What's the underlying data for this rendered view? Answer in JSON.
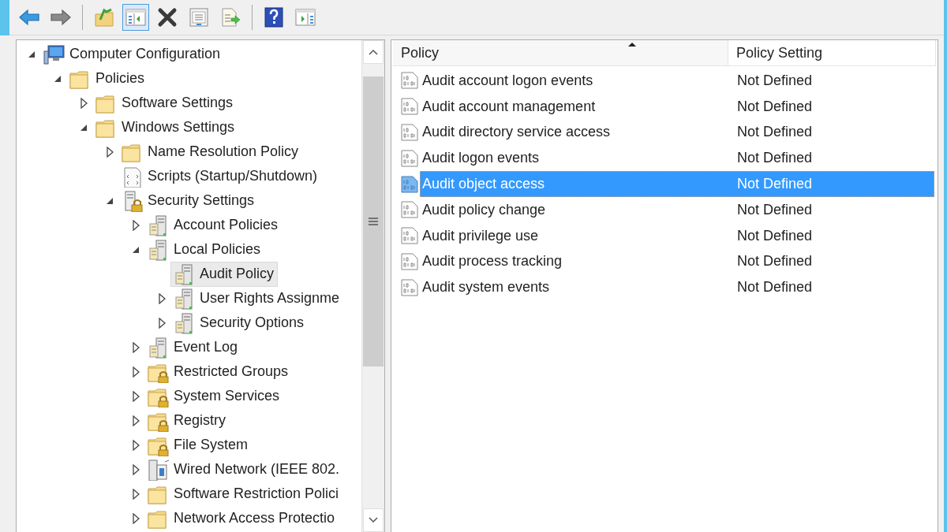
{
  "toolbar": [
    {
      "kind": "back",
      "pressed": false,
      "disabled": false
    },
    {
      "kind": "forward",
      "pressed": false,
      "disabled": true
    },
    {
      "kind": "separator"
    },
    {
      "kind": "up",
      "pressed": false,
      "disabled": false
    },
    {
      "kind": "console-tree",
      "pressed": true,
      "disabled": false
    },
    {
      "kind": "delete",
      "pressed": false,
      "disabled": false
    },
    {
      "kind": "properties",
      "pressed": false,
      "disabled": false
    },
    {
      "kind": "export",
      "pressed": false,
      "disabled": false
    },
    {
      "kind": "separator"
    },
    {
      "kind": "help",
      "pressed": false,
      "disabled": false
    },
    {
      "kind": "action-pane",
      "pressed": false,
      "disabled": false
    }
  ],
  "tree": [
    {
      "label": "Computer Configuration",
      "kind": "computer",
      "expanded": true,
      "selected": false,
      "children": [
        {
          "label": "Policies",
          "kind": "folder",
          "expanded": true,
          "selected": false,
          "children": [
            {
              "label": "Software Settings",
              "kind": "folder",
              "expanded": false,
              "selected": false
            },
            {
              "label": "Windows Settings",
              "kind": "folder",
              "expanded": true,
              "selected": false,
              "children": [
                {
                  "label": "Name Resolution Policy",
                  "kind": "folder",
                  "expanded": false,
                  "selected": false
                },
                {
                  "label": "Scripts (Startup/Shutdown)",
                  "kind": "script",
                  "selected": false
                },
                {
                  "label": "Security Settings",
                  "kind": "security",
                  "expanded": true,
                  "selected": false,
                  "children": [
                    {
                      "label": "Account Policies",
                      "kind": "server",
                      "expanded": false,
                      "selected": false
                    },
                    {
                      "label": "Local Policies",
                      "kind": "server",
                      "expanded": true,
                      "selected": false,
                      "children": [
                        {
                          "label": "Audit Policy",
                          "kind": "server",
                          "selected": true
                        },
                        {
                          "label": "User Rights Assignme",
                          "kind": "server",
                          "expanded": false,
                          "selected": false
                        },
                        {
                          "label": "Security Options",
                          "kind": "server",
                          "expanded": false,
                          "selected": false
                        }
                      ]
                    },
                    {
                      "label": "Event Log",
                      "kind": "server",
                      "expanded": false,
                      "selected": false
                    },
                    {
                      "label": "Restricted Groups",
                      "kind": "lockfolder",
                      "expanded": false,
                      "selected": false
                    },
                    {
                      "label": "System Services",
                      "kind": "lockfolder",
                      "expanded": false,
                      "selected": false
                    },
                    {
                      "label": "Registry",
                      "kind": "lockfolder",
                      "expanded": false,
                      "selected": false
                    },
                    {
                      "label": "File System",
                      "kind": "lockfolder",
                      "expanded": false,
                      "selected": false
                    },
                    {
                      "label": "Wired Network (IEEE 802.",
                      "kind": "network",
                      "expanded": false,
                      "selected": false
                    },
                    {
                      "label": "Software Restriction Polici",
                      "kind": "folder",
                      "expanded": false,
                      "selected": false
                    },
                    {
                      "label": "Network Access Protectio",
                      "kind": "folder",
                      "expanded": false,
                      "selected": false
                    }
                  ]
                }
              ]
            }
          ]
        }
      ]
    }
  ],
  "table": {
    "columns": [
      {
        "label": "Policy",
        "sorted": true
      },
      {
        "label": "Policy Setting",
        "sorted": false
      }
    ],
    "rows": [
      {
        "policy": "Audit account logon events",
        "setting": "Not Defined",
        "selected": false
      },
      {
        "policy": "Audit account management",
        "setting": "Not Defined",
        "selected": false
      },
      {
        "policy": "Audit directory service access",
        "setting": "Not Defined",
        "selected": false
      },
      {
        "policy": "Audit logon events",
        "setting": "Not Defined",
        "selected": false
      },
      {
        "policy": "Audit object access",
        "setting": "Not Defined",
        "selected": true
      },
      {
        "policy": "Audit policy change",
        "setting": "Not Defined",
        "selected": false
      },
      {
        "policy": "Audit privilege use",
        "setting": "Not Defined",
        "selected": false
      },
      {
        "policy": "Audit process tracking",
        "setting": "Not Defined",
        "selected": false
      },
      {
        "policy": "Audit system events",
        "setting": "Not Defined",
        "selected": false
      }
    ]
  }
}
